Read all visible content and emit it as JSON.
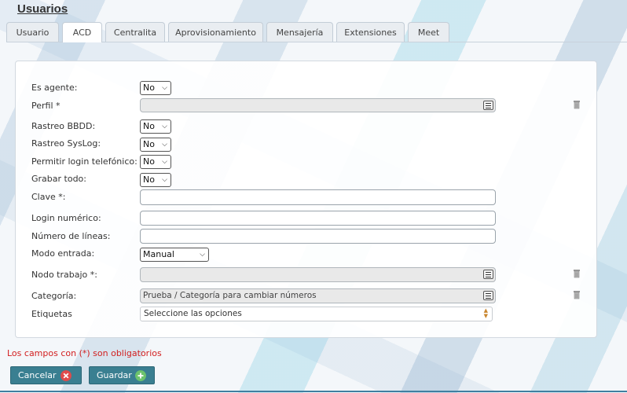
{
  "page": {
    "title": "Usuarios"
  },
  "tabs": [
    {
      "label": "Usuario"
    },
    {
      "label": "ACD",
      "active": true
    },
    {
      "label": "Centralita"
    },
    {
      "label": "Aprovisionamiento"
    },
    {
      "label": "Mensajería"
    },
    {
      "label": "Extensiones"
    },
    {
      "label": "Meet"
    }
  ],
  "form": {
    "es_agente": {
      "label": "Es agente:",
      "value": "No"
    },
    "perfil": {
      "label": "Perfil *",
      "value": ""
    },
    "rastreo_bbdd": {
      "label": "Rastreo BBDD:",
      "value": "No"
    },
    "rastreo_syslog": {
      "label": "Rastreo SysLog:",
      "value": "No"
    },
    "permitir_login": {
      "label": "Permitir login telefónico:",
      "value": "No"
    },
    "grabar_todo": {
      "label": "Grabar todo:",
      "value": "No"
    },
    "clave": {
      "label": "Clave *:",
      "value": ""
    },
    "login_numerico": {
      "label": "Login numérico:",
      "value": ""
    },
    "numero_lineas": {
      "label": "Número de líneas:",
      "value": ""
    },
    "modo_entrada": {
      "label": "Modo entrada:",
      "value": "Manual"
    },
    "nodo_trabajo": {
      "label": "Nodo trabajo *:",
      "value": ""
    },
    "categoria": {
      "label": "Categoría:",
      "value": "Prueba / Categoría para cambiar números"
    },
    "etiquetas": {
      "label": "Etiquetas",
      "placeholder": "Seleccione las opciones"
    }
  },
  "required_note": "Los campos con (*) son obligatorios",
  "buttons": {
    "cancel": "Cancelar",
    "save": "Guardar"
  },
  "colors": {
    "button_bg": "#3a7f91",
    "cancel_icon": "#e04b4b",
    "save_icon": "#6cc36c",
    "note": "#d21e1e"
  }
}
